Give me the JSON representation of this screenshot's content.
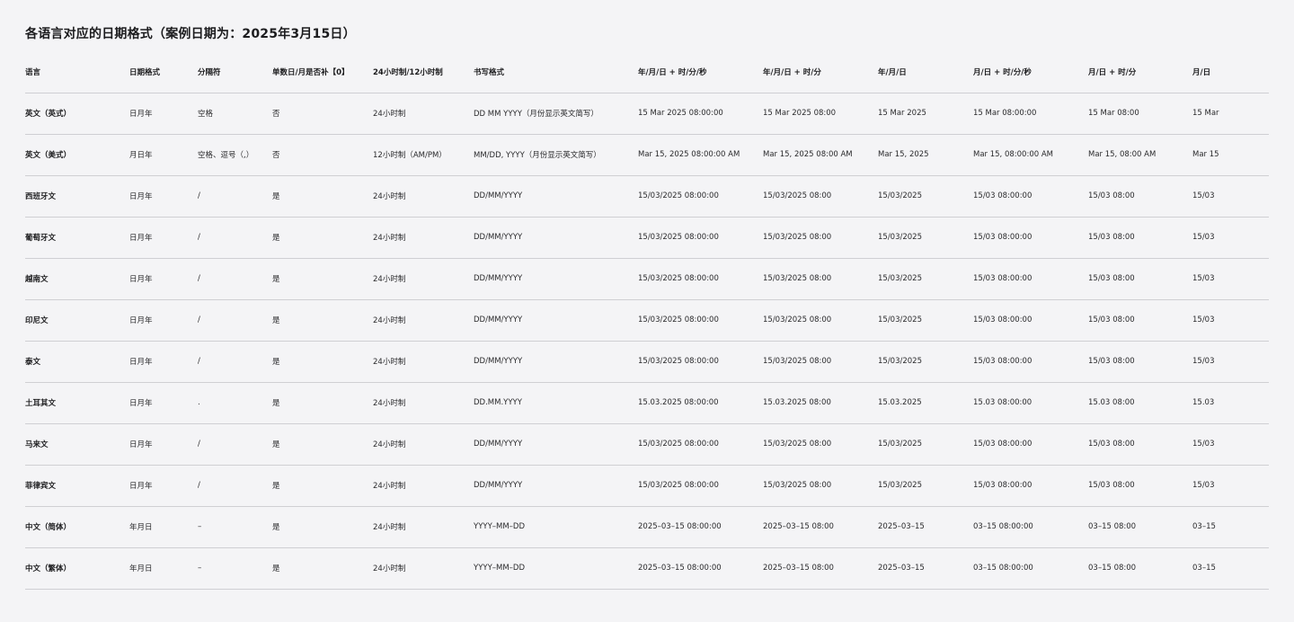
{
  "title": "各语言对应的日期格式（案例日期为：2025年3月15日）",
  "columns": [
    "语言",
    "日期格式",
    "分隔符",
    "单数日/月是否补【0】",
    "24小时制/12小时制",
    "书写格式",
    "年/月/日 + 时/分/秒",
    "年/月/日 + 时/分",
    "年/月/日",
    "月/日 + 时/分/秒",
    "月/日 + 时/分",
    "月/日"
  ],
  "rows": [
    [
      "英文（英式）",
      "日月年",
      "空格",
      "否",
      "24小时制",
      "DD MM YYYY（月份显示英文简写）",
      "15 Mar 2025 08:00:00",
      "15 Mar 2025 08:00",
      "15 Mar 2025",
      "15 Mar 08:00:00",
      "15 Mar 08:00",
      "15 Mar"
    ],
    [
      "英文（美式）",
      "月日年",
      "空格、逗号（,）",
      "否",
      "12小时制（AM/PM）",
      "MM/DD, YYYY（月份显示英文简写）",
      "Mar 15, 2025 08:00:00 AM",
      "Mar 15, 2025 08:00 AM",
      "Mar 15, 2025",
      "Mar 15, 08:00:00 AM",
      "Mar 15, 08:00 AM",
      "Mar 15"
    ],
    [
      "西班牙文",
      "日月年",
      "/",
      "是",
      "24小时制",
      "DD/MM/YYYY",
      "15/03/2025 08:00:00",
      "15/03/2025 08:00",
      "15/03/2025",
      "15/03 08:00:00",
      "15/03 08:00",
      "15/03"
    ],
    [
      "葡萄牙文",
      "日月年",
      "/",
      "是",
      "24小时制",
      "DD/MM/YYYY",
      "15/03/2025 08:00:00",
      "15/03/2025 08:00",
      "15/03/2025",
      "15/03 08:00:00",
      "15/03 08:00",
      "15/03"
    ],
    [
      "越南文",
      "日月年",
      "/",
      "是",
      "24小时制",
      "DD/MM/YYYY",
      "15/03/2025 08:00:00",
      "15/03/2025 08:00",
      "15/03/2025",
      "15/03 08:00:00",
      "15/03 08:00",
      "15/03"
    ],
    [
      "印尼文",
      "日月年",
      "/",
      "是",
      "24小时制",
      "DD/MM/YYYY",
      "15/03/2025 08:00:00",
      "15/03/2025 08:00",
      "15/03/2025",
      "15/03 08:00:00",
      "15/03 08:00",
      "15/03"
    ],
    [
      "泰文",
      "日月年",
      "/",
      "是",
      "24小时制",
      "DD/MM/YYYY",
      "15/03/2025 08:00:00",
      "15/03/2025 08:00",
      "15/03/2025",
      "15/03 08:00:00",
      "15/03 08:00",
      "15/03"
    ],
    [
      "土耳其文",
      "日月年",
      ".",
      "是",
      "24小时制",
      "DD.MM.YYYY",
      "15.03.2025 08:00:00",
      "15.03.2025 08:00",
      "15.03.2025",
      "15.03 08:00:00",
      "15.03 08:00",
      "15.03"
    ],
    [
      "马来文",
      "日月年",
      "/",
      "是",
      "24小时制",
      "DD/MM/YYYY",
      "15/03/2025 08:00:00",
      "15/03/2025 08:00",
      "15/03/2025",
      "15/03 08:00:00",
      "15/03 08:00",
      "15/03"
    ],
    [
      "菲律宾文",
      "日月年",
      "/",
      "是",
      "24小时制",
      "DD/MM/YYYY",
      "15/03/2025 08:00:00",
      "15/03/2025 08:00",
      "15/03/2025",
      "15/03 08:00:00",
      "15/03 08:00",
      "15/03"
    ],
    [
      "中文（简体）",
      "年月日",
      "–",
      "是",
      "24小时制",
      "YYYY–MM–DD",
      "2025–03–15 08:00:00",
      "2025–03–15 08:00",
      "2025–03–15",
      "03–15 08:00:00",
      "03–15 08:00",
      "03–15"
    ],
    [
      "中文（繁体）",
      "年月日",
      "–",
      "是",
      "24小时制",
      "YYYY–MM–DD",
      "2025–03–15 08:00:00",
      "2025–03–15 08:00",
      "2025–03–15",
      "03–15 08:00:00",
      "03–15 08:00",
      "03–15"
    ]
  ]
}
